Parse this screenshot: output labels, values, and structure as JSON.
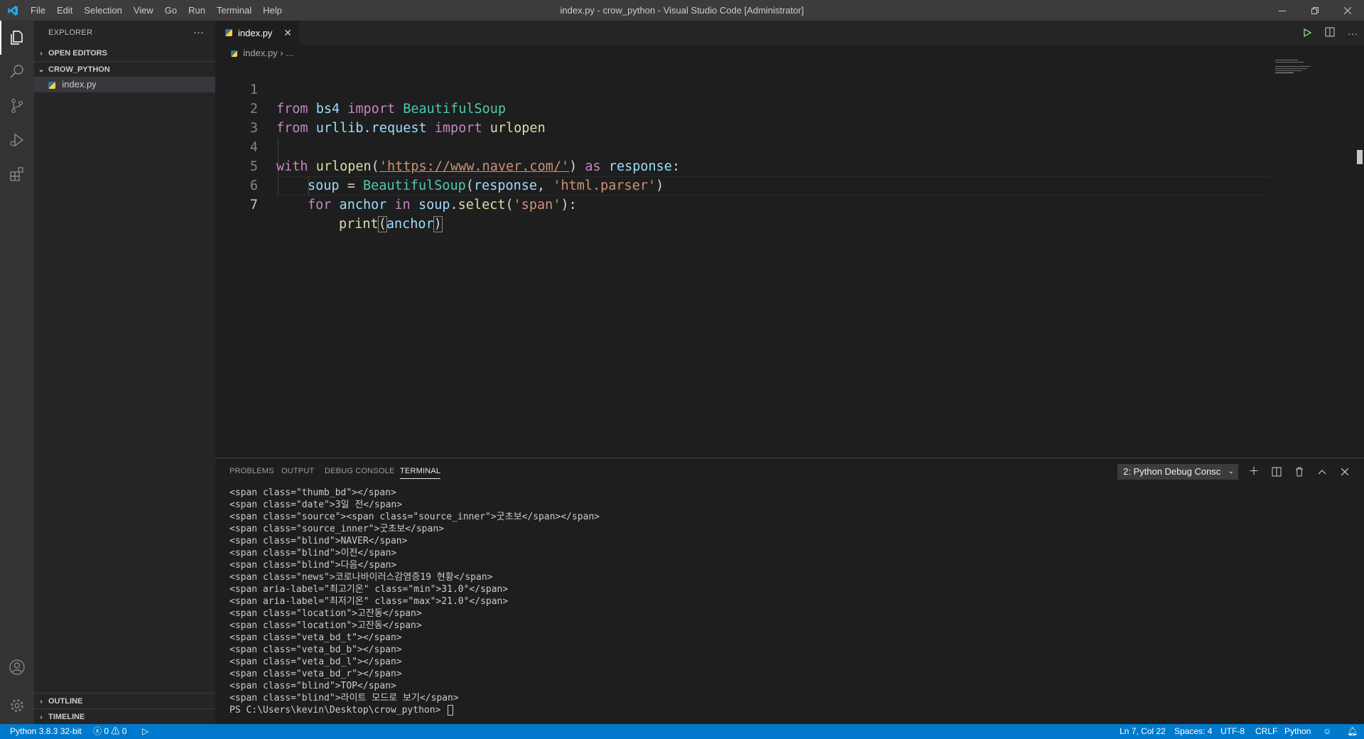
{
  "titlebar": {
    "menu": [
      "File",
      "Edit",
      "Selection",
      "View",
      "Go",
      "Run",
      "Terminal",
      "Help"
    ],
    "title": "index.py - crow_python - Visual Studio Code [Administrator]"
  },
  "activitybar": {
    "icons": [
      "explorer-icon",
      "search-icon",
      "source-control-icon",
      "run-debug-icon",
      "extensions-icon",
      "account-icon",
      "settings-gear-icon"
    ]
  },
  "sidebar": {
    "header": "EXPLORER",
    "more": "···",
    "open_editors": "OPEN EDITORS",
    "folder": "CROW_PYTHON",
    "files": [
      "index.py"
    ],
    "outline": "OUTLINE",
    "timeline": "TIMELINE"
  },
  "editor": {
    "tab_label": "index.py",
    "breadcrumb_file": "index.py",
    "breadcrumb_rest": "...",
    "line_numbers": [
      "1",
      "2",
      "3",
      "4",
      "5",
      "6",
      "7"
    ],
    "code": {
      "l1": {
        "kw1": "from",
        "mod": " bs4 ",
        "kw2": "import",
        "cls": " BeautifulSoup"
      },
      "l2": {
        "kw1": "from",
        "mod": " urllib.request ",
        "kw2": "import",
        "fn": " urlopen"
      },
      "l4": {
        "kw1": "with",
        "fn": " urlopen",
        "p1": "(",
        "str": "'https://www.naver.com/'",
        "p2": ") ",
        "kw2": "as",
        "var": " response",
        "p3": ":"
      },
      "l5": {
        "var1": "soup",
        "op": " = ",
        "cls": "BeautifulSoup",
        "p1": "(",
        "var2": "response",
        "p2": ", ",
        "str": "'html.parser'",
        "p3": ")"
      },
      "l6": {
        "kw1": "for",
        "var1": " anchor ",
        "kw2": "in",
        "var2": " soup",
        "p1": ".",
        "fn": "select",
        "p2": "(",
        "str": "'span'",
        "p3": "):"
      },
      "l7": {
        "fn": "print",
        "p1": "(",
        "var": "anchor",
        "p2": ")"
      }
    }
  },
  "panel": {
    "tabs": [
      "PROBLEMS",
      "OUTPUT",
      "DEBUG CONSOLE",
      "TERMINAL"
    ],
    "active_tab": "TERMINAL",
    "terminal_select": "2: Python Debug Consc",
    "terminal_lines": [
      "<span class=\"thumb_bd\"></span>",
      "<span class=\"date\">3일 전</span>",
      "<span class=\"source\"><span class=\"source_inner\">굿초보</span></span>",
      "<span class=\"source_inner\">굿초보</span>",
      "<span class=\"blind\">NAVER</span>",
      "<span class=\"blind\">이전</span>",
      "<span class=\"blind\">다음</span>",
      "<span class=\"news\">코로나바이러스감염증19 현황</span>",
      "<span aria-label=\"최고기온\" class=\"min\">31.0°</span>",
      "<span aria-label=\"최저기온\" class=\"max\">21.0°</span>",
      "<span class=\"location\">고잔동</span>",
      "<span class=\"location\">고잔동</span>",
      "<span class=\"veta_bd_t\"></span>",
      "<span class=\"veta_bd_b\"></span>",
      "<span class=\"veta_bd_l\"></span>",
      "<span class=\"veta_bd_r\"></span>",
      "<span class=\"blind\">TOP</span>",
      "<span class=\"blind\">라이트 모드로 보기</span>",
      "PS C:\\Users\\kevin\\Desktop\\crow_python> "
    ]
  },
  "statusbar": {
    "python": "Python 3.8.3 32-bit",
    "errors": "0",
    "warnings": "0",
    "position": "Ln 7, Col 22",
    "spaces": "Spaces: 4",
    "encoding": "UTF-8",
    "eol": "CRLF",
    "language": "Python"
  },
  "colors": {
    "statusbar": "#007acc",
    "activitybar": "#333333",
    "sidebar": "#252526",
    "editor": "#1e1e1e",
    "titlebar": "#3c3c3c"
  }
}
